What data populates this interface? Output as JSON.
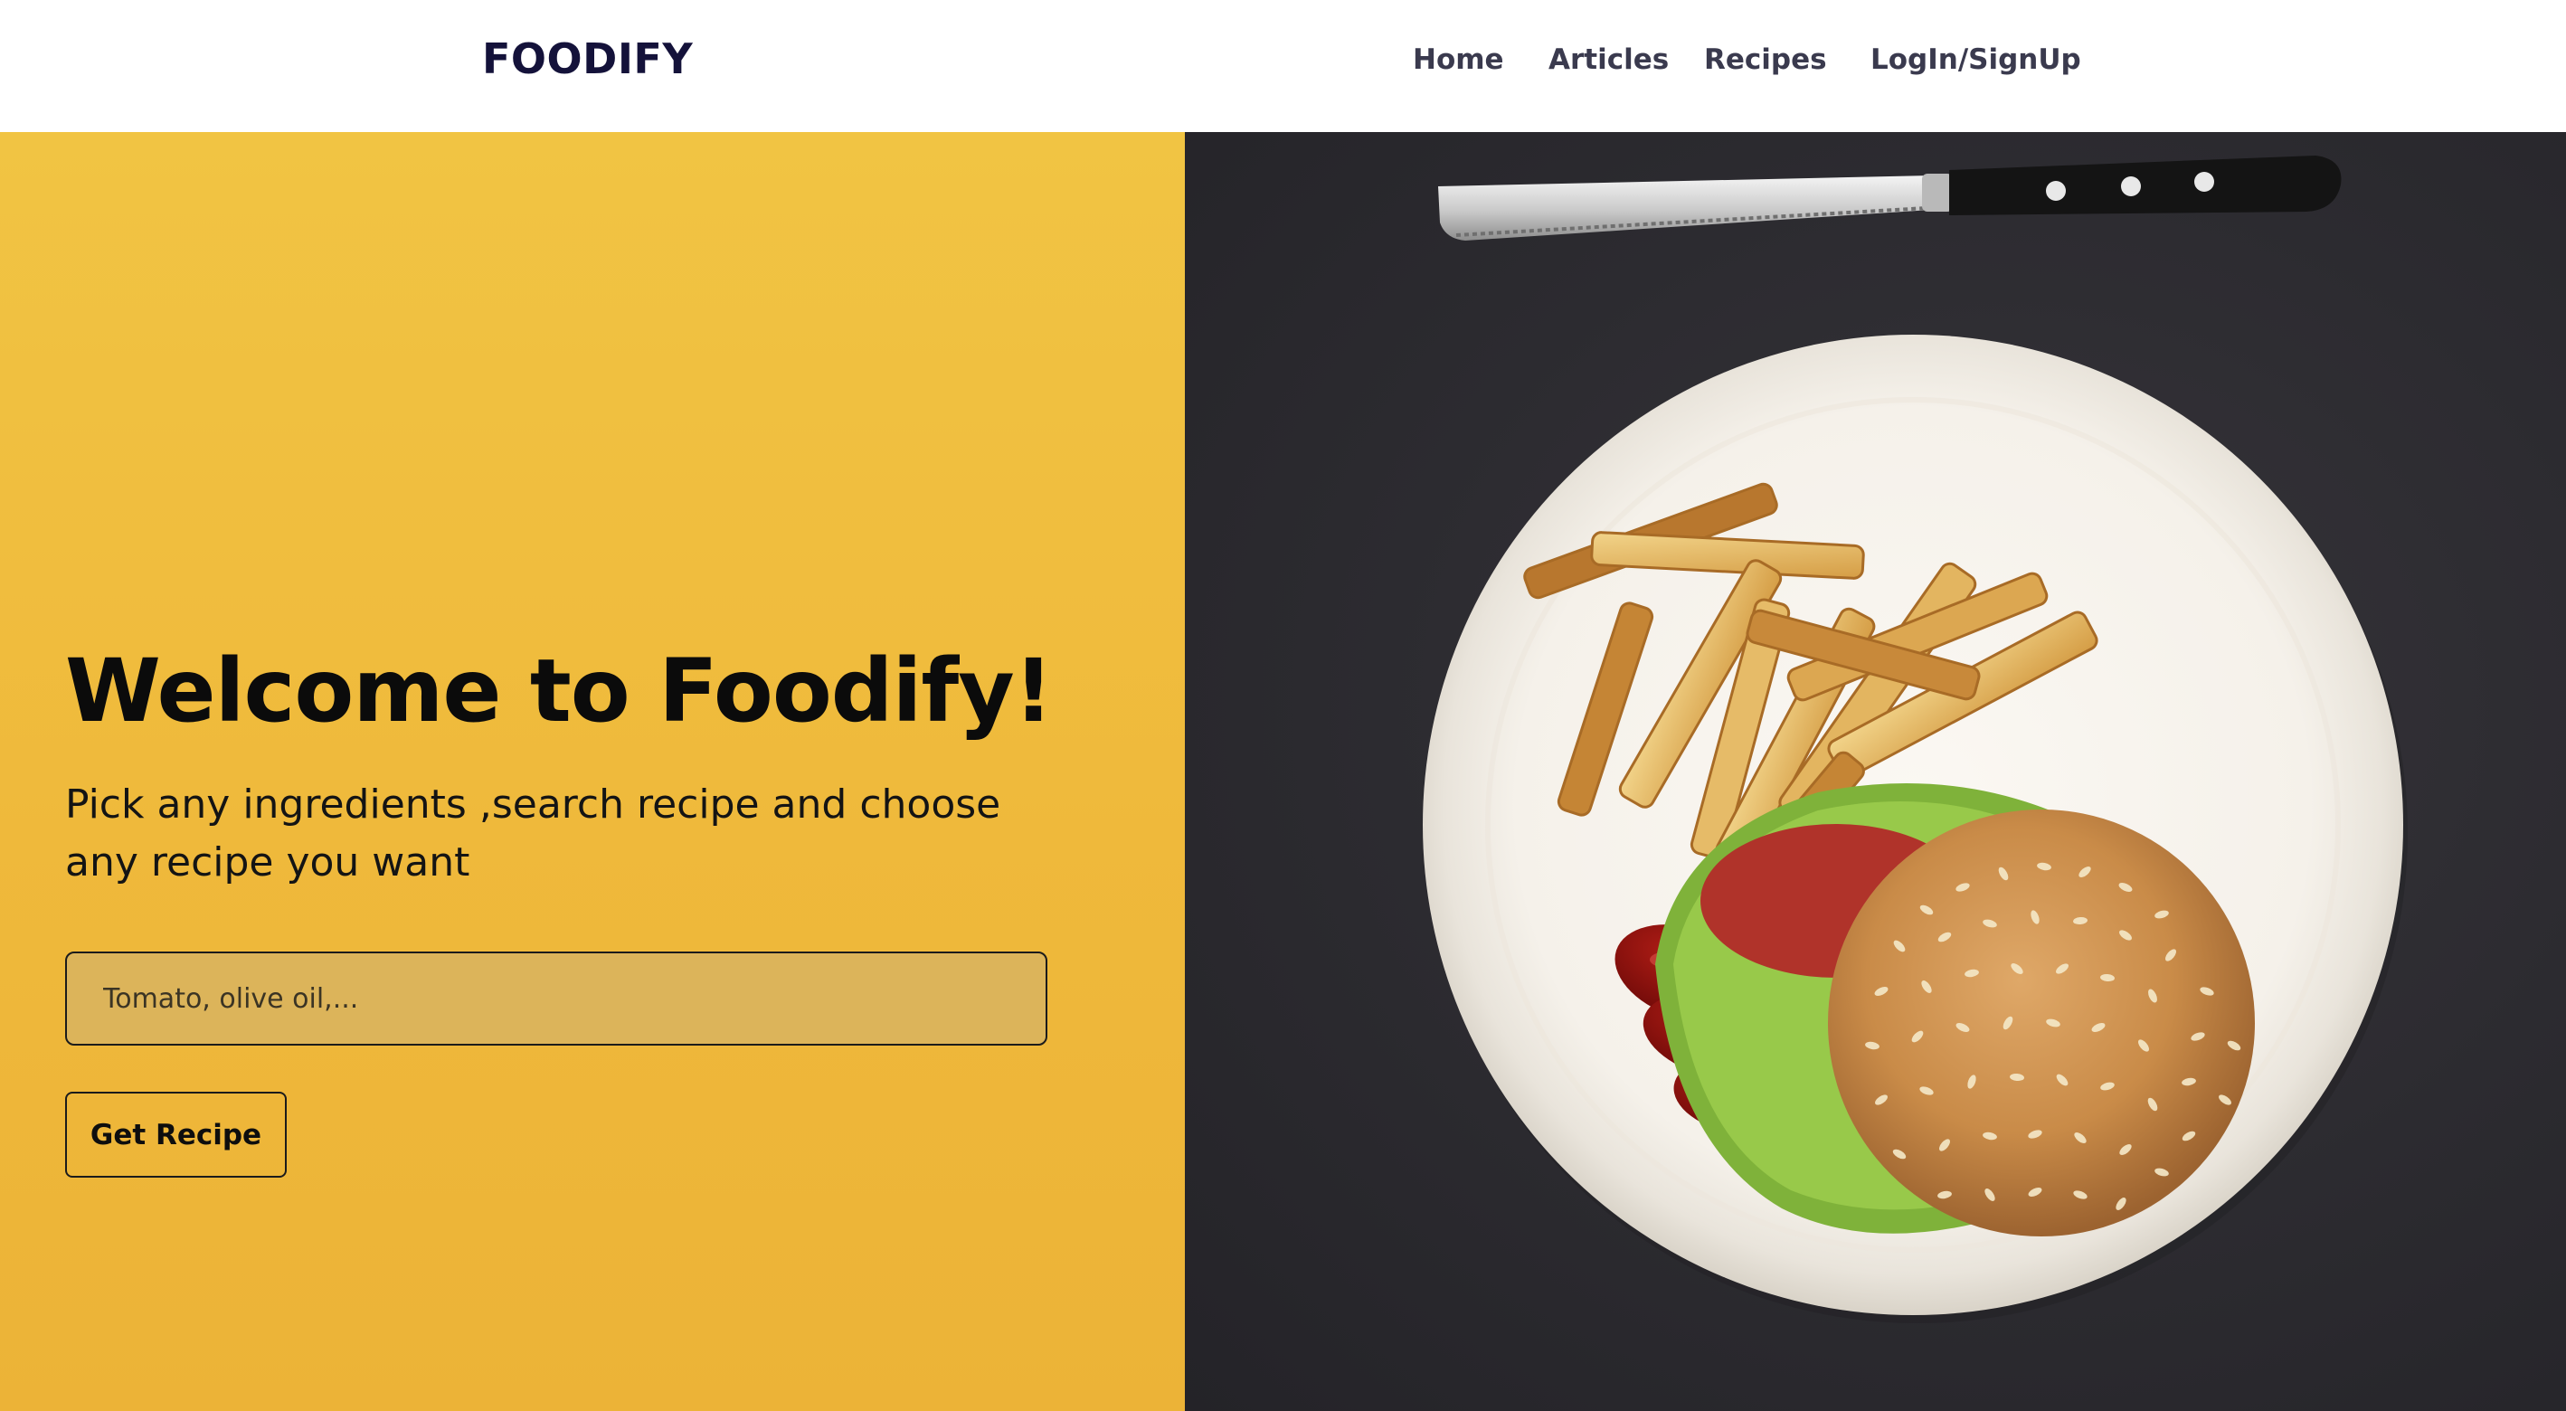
{
  "brand": {
    "name": "FOODIFY"
  },
  "nav": {
    "home": "Home",
    "articles": "Articles",
    "recipes": "Recipes",
    "login": "LogIn/SignUp"
  },
  "hero": {
    "title": "Welcome to Foodify!",
    "subtitle": "Pick any ingredients ,search recipe and choose any recipe you want",
    "search_placeholder": "Tomato, olive oil,...",
    "search_value": "",
    "button_label": "Get Recipe"
  },
  "image": {
    "subject": "burger-fries-ketchup-plate-with-knife"
  },
  "colors": {
    "brand_text": "#14123a",
    "hero_left_bg": "#f0bd3e",
    "hero_right_bg": "#2d2c31",
    "input_bg": "#dcb45a",
    "nav_text": "#3a3a4e"
  },
  "icons": [
    "knife-icon",
    "plate-icon",
    "burger-icon",
    "fries-icon",
    "ketchup-icon"
  ]
}
